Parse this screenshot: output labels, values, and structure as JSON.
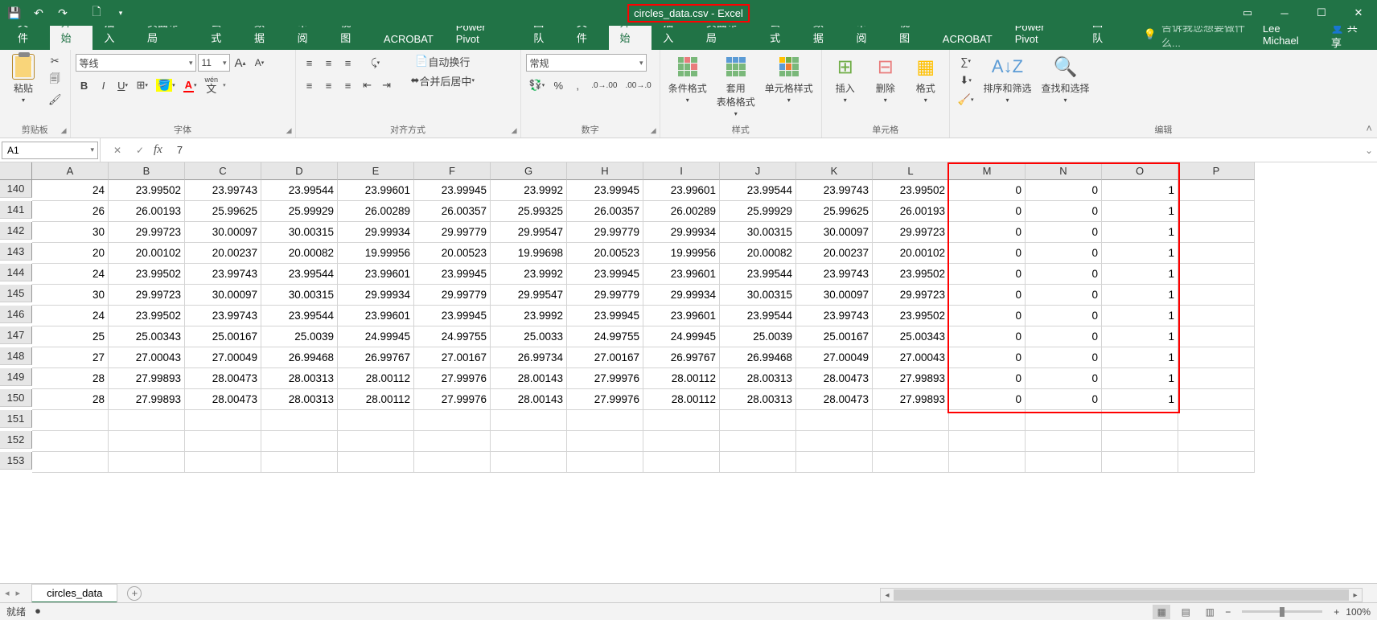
{
  "title": "circles_data.csv - Excel",
  "user": "Lee Michael",
  "share": "共享",
  "tabs": [
    "文件",
    "开始",
    "插入",
    "页面布局",
    "公式",
    "数据",
    "审阅",
    "视图",
    "ACROBAT",
    "Power Pivot",
    "团队"
  ],
  "active_tab": "开始",
  "tell_me_placeholder": "告诉我您想要做什么...",
  "ribbon": {
    "clipboard_group": "剪贴板",
    "paste": "粘贴",
    "font_group": "字体",
    "font_name": "等线",
    "font_size": "11",
    "wen": "wén",
    "wen2": "文",
    "align_group": "对齐方式",
    "wrap_text": "自动换行",
    "merge_center": "合并后居中",
    "number_group": "数字",
    "number_format": "常规",
    "styles_group": "样式",
    "cond_fmt": "条件格式",
    "cell_styles": "单元格样式",
    "format_table": "套用\n表格格式",
    "cells_group": "单元格",
    "insert": "插入",
    "delete": "删除",
    "format": "格式",
    "editing_group": "编辑",
    "sort_filter": "排序和筛选",
    "find_select": "查找和选择"
  },
  "name_box": "A1",
  "formula_value": "7",
  "columns": [
    "A",
    "B",
    "C",
    "D",
    "E",
    "F",
    "G",
    "H",
    "I",
    "J",
    "K",
    "L",
    "M",
    "N",
    "O",
    "P"
  ],
  "row_headers": [
    "140",
    "141",
    "142",
    "143",
    "144",
    "145",
    "146",
    "147",
    "148",
    "149",
    "150",
    "151",
    "152",
    "153"
  ],
  "rows": [
    [
      "24",
      "23.99502",
      "23.99743",
      "23.99544",
      "23.99601",
      "23.99945",
      "23.9992",
      "23.99945",
      "23.99601",
      "23.99544",
      "23.99743",
      "23.99502",
      "0",
      "0",
      "1",
      ""
    ],
    [
      "26",
      "26.00193",
      "25.99625",
      "25.99929",
      "26.00289",
      "26.00357",
      "25.99325",
      "26.00357",
      "26.00289",
      "25.99929",
      "25.99625",
      "26.00193",
      "0",
      "0",
      "1",
      ""
    ],
    [
      "30",
      "29.99723",
      "30.00097",
      "30.00315",
      "29.99934",
      "29.99779",
      "29.99547",
      "29.99779",
      "29.99934",
      "30.00315",
      "30.00097",
      "29.99723",
      "0",
      "0",
      "1",
      ""
    ],
    [
      "20",
      "20.00102",
      "20.00237",
      "20.00082",
      "19.99956",
      "20.00523",
      "19.99698",
      "20.00523",
      "19.99956",
      "20.00082",
      "20.00237",
      "20.00102",
      "0",
      "0",
      "1",
      ""
    ],
    [
      "24",
      "23.99502",
      "23.99743",
      "23.99544",
      "23.99601",
      "23.99945",
      "23.9992",
      "23.99945",
      "23.99601",
      "23.99544",
      "23.99743",
      "23.99502",
      "0",
      "0",
      "1",
      ""
    ],
    [
      "30",
      "29.99723",
      "30.00097",
      "30.00315",
      "29.99934",
      "29.99779",
      "29.99547",
      "29.99779",
      "29.99934",
      "30.00315",
      "30.00097",
      "29.99723",
      "0",
      "0",
      "1",
      ""
    ],
    [
      "24",
      "23.99502",
      "23.99743",
      "23.99544",
      "23.99601",
      "23.99945",
      "23.9992",
      "23.99945",
      "23.99601",
      "23.99544",
      "23.99743",
      "23.99502",
      "0",
      "0",
      "1",
      ""
    ],
    [
      "25",
      "25.00343",
      "25.00167",
      "25.0039",
      "24.99945",
      "24.99755",
      "25.0033",
      "24.99755",
      "24.99945",
      "25.0039",
      "25.00167",
      "25.00343",
      "0",
      "0",
      "1",
      ""
    ],
    [
      "27",
      "27.00043",
      "27.00049",
      "26.99468",
      "26.99767",
      "27.00167",
      "26.99734",
      "27.00167",
      "26.99767",
      "26.99468",
      "27.00049",
      "27.00043",
      "0",
      "0",
      "1",
      ""
    ],
    [
      "28",
      "27.99893",
      "28.00473",
      "28.00313",
      "28.00112",
      "27.99976",
      "28.00143",
      "27.99976",
      "28.00112",
      "28.00313",
      "28.00473",
      "27.99893",
      "0",
      "0",
      "1",
      ""
    ],
    [
      "28",
      "27.99893",
      "28.00473",
      "28.00313",
      "28.00112",
      "27.99976",
      "28.00143",
      "27.99976",
      "28.00112",
      "28.00313",
      "28.00473",
      "27.99893",
      "0",
      "0",
      "1",
      ""
    ],
    [
      "",
      "",
      "",
      "",
      "",
      "",
      "",
      "",
      "",
      "",
      "",
      "",
      "",
      "",
      "",
      ""
    ],
    [
      "",
      "",
      "",
      "",
      "",
      "",
      "",
      "",
      "",
      "",
      "",
      "",
      "",
      "",
      "",
      ""
    ],
    [
      "",
      "",
      "",
      "",
      "",
      "",
      "",
      "",
      "",
      "",
      "",
      "",
      "",
      "",
      "",
      ""
    ]
  ],
  "sheet_tab": "circles_data",
  "status_ready": "就绪",
  "zoom": "100%"
}
